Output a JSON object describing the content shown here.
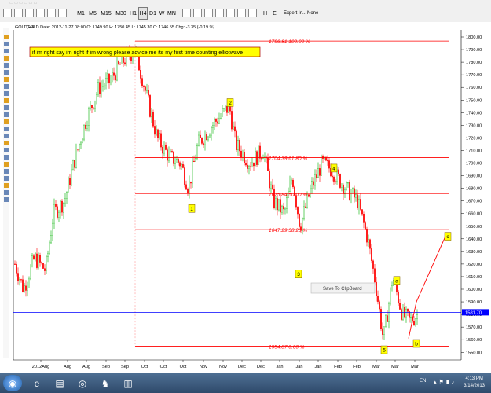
{
  "toolbar": {
    "timeframes": [
      "M1",
      "M5",
      "M15",
      "M30",
      "H1",
      "H4",
      "D1",
      "W",
      "MN"
    ],
    "active_timeframe": "H4",
    "extra_labels": [
      "H",
      "E"
    ],
    "expert_label": "Expert In...",
    "expert_value": "None"
  },
  "chart": {
    "symbol_title": "GOLD,H4",
    "info_line": "GOLD  Date: 2012-11-27 08:00  O: 1749.90  H: 1750.45  L: 1745.30  C: 1746.55  Chg: -3.35 (-0.19 %)",
    "annotation": "if im right say im right if im wrong please advice me its my first time counting elliotwave",
    "context_menu_item": "Save To ClipBoard",
    "current_price": "1581.70",
    "x_labels": [
      "2012Aug",
      "Aug",
      "Aug",
      "Sep",
      "Sep",
      "Oct",
      "Oct",
      "Oct",
      "Nov",
      "Nov",
      "Dec",
      "Dec",
      "Jan",
      "Jan",
      "Jan",
      "Feb",
      "Feb",
      "Mar",
      "Mar",
      "Mar"
    ],
    "y_ticks": [
      1550,
      1560,
      1570,
      1580,
      1590,
      1600,
      1610,
      1620,
      1630,
      1640,
      1650,
      1660,
      1670,
      1680,
      1690,
      1700,
      1710,
      1720,
      1730,
      1740,
      1750,
      1760,
      1770,
      1780,
      1790,
      1800
    ],
    "fib_levels": [
      {
        "price": 1796.81,
        "label": "1796.81   100.00 %"
      },
      {
        "price": 1704.39,
        "label": "1704.39   61.80 %"
      },
      {
        "price": 1675.84,
        "label": "1675.84   50.00 %"
      },
      {
        "price": 1647.29,
        "label": "1647.29   38.20 %"
      },
      {
        "price": 1554.87,
        "label": "1554.87   0.00 %"
      }
    ],
    "wave_labels": [
      "1",
      "2",
      "3",
      "4",
      "5",
      "a",
      "b",
      "c"
    ],
    "colors": {
      "up": "#00b000",
      "down": "#ff0000",
      "fib": "#ff0000",
      "price_line": "#0000ff",
      "label_bg": "#ffff00"
    }
  },
  "taskbar": {
    "language": "EN",
    "time": "4:13 PM",
    "date": "3/14/2013"
  }
}
